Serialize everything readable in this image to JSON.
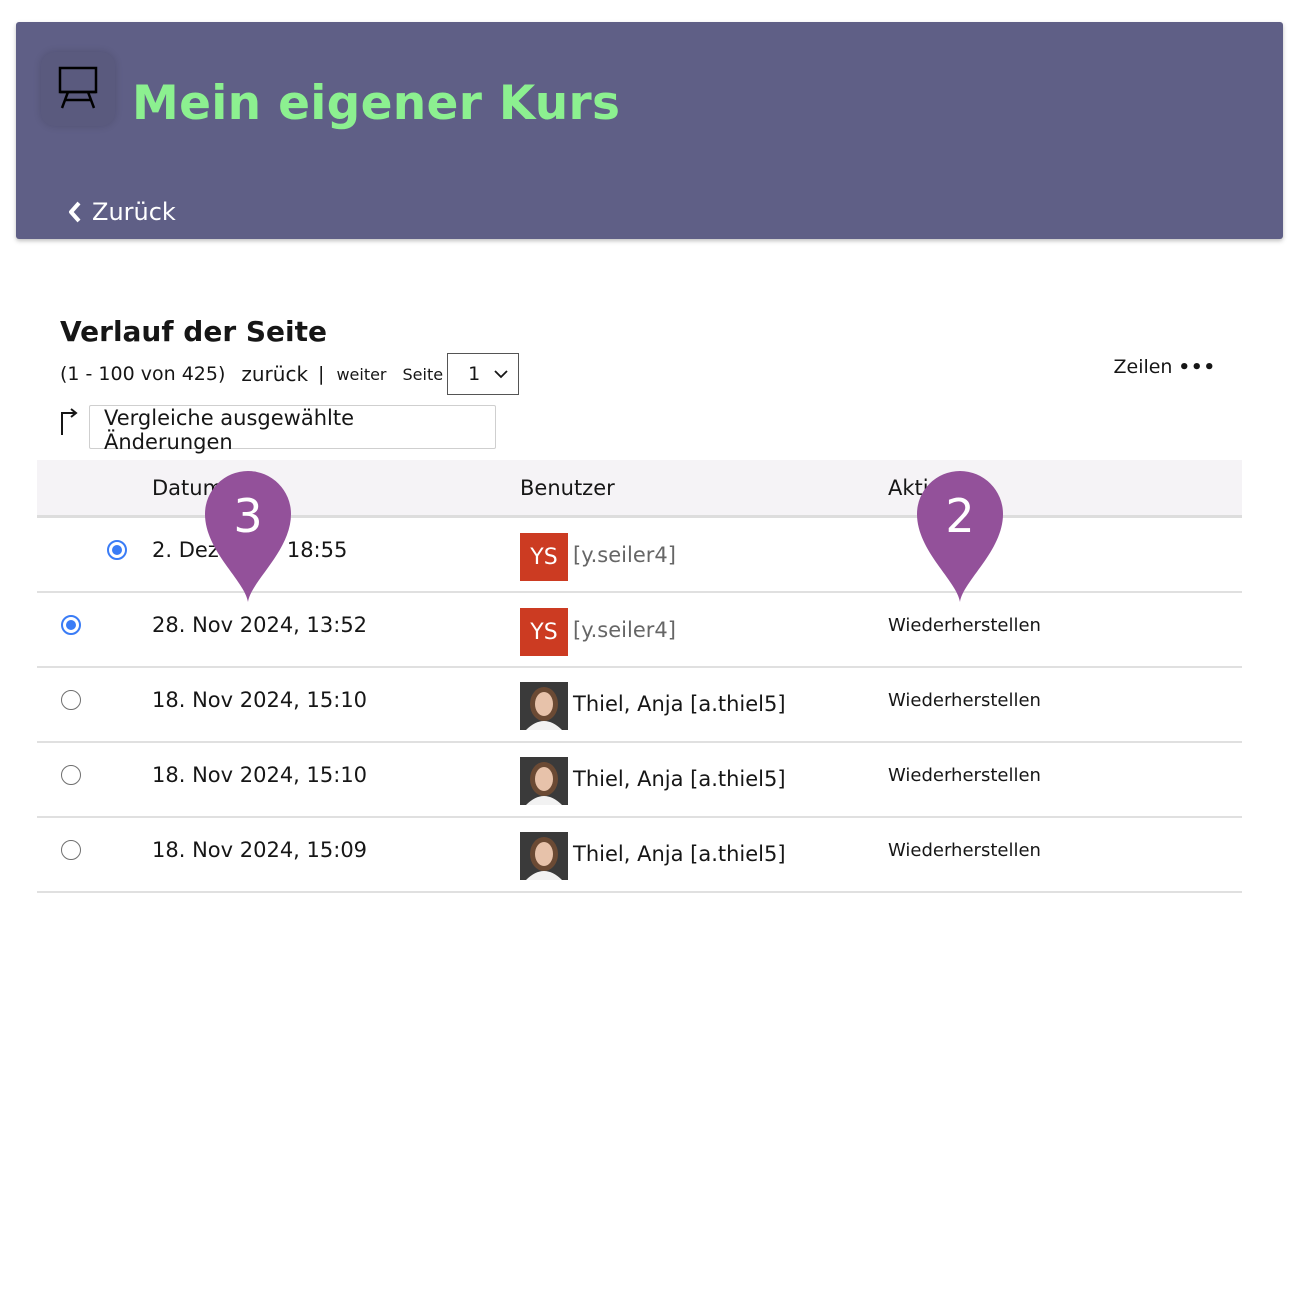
{
  "header": {
    "title": "Mein eigener Kurs",
    "back_label": "Zurück",
    "background_color": "#5f5f86",
    "title_color": "#8cf090",
    "course_icon": "presentation-board-icon"
  },
  "history": {
    "title": "Verlauf der Seite",
    "pager": {
      "range": "(1 - 100 von 425)",
      "prev_label": "zurück",
      "separator": "|",
      "next_label": "weiter",
      "page_label": "Seite",
      "page_value": "1"
    },
    "rows_menu_label": "Zeilen",
    "compare_button_label": "Vergleiche ausgewählte Änderungen",
    "columns": {
      "date": "Datum",
      "user": "Benutzer",
      "action": "Akti"
    },
    "rows": [
      {
        "date": "2. Dez",
        "time": "18:55",
        "initials": "YS",
        "user": "[y.seiler4]",
        "action": ""
      },
      {
        "date": "28. Nov 2024, 13:52",
        "initials": "YS",
        "user": "[y.seiler4]",
        "action": "Wiederherstellen"
      },
      {
        "date": "18. Nov 2024, 15:10",
        "user": "Thiel, Anja [a.thiel5]",
        "action": "Wiederherstellen"
      },
      {
        "date": "18. Nov 2024, 15:10",
        "user": "Thiel, Anja [a.thiel5]",
        "action": "Wiederherstellen"
      },
      {
        "date": "18. Nov 2024, 15:09",
        "user": "Thiel, Anja [a.thiel5]",
        "action": "Wiederherstellen"
      }
    ]
  },
  "markers": [
    {
      "label": "3",
      "color": "#93519a"
    },
    {
      "label": "2",
      "color": "#93519a"
    }
  ]
}
